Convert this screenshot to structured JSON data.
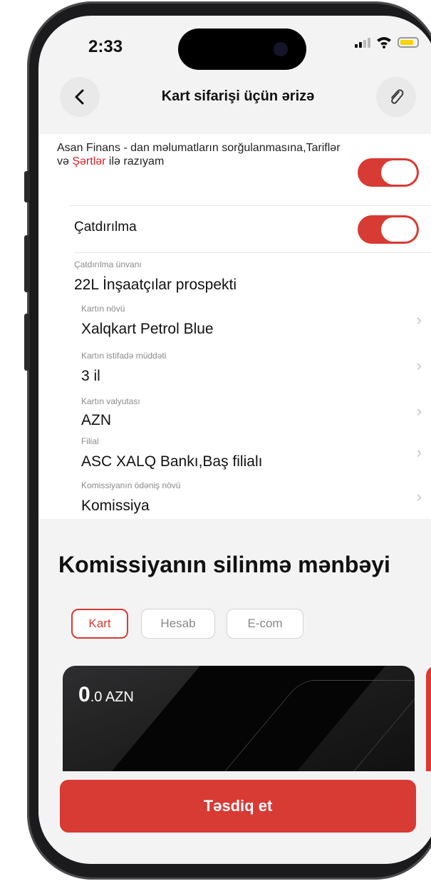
{
  "status_bar": {
    "time": "2:33"
  },
  "header": {
    "title": "Kart sifarişi üçün ərizə",
    "back_icon": "chevron-left-icon",
    "attach_icon": "paperclip-icon"
  },
  "consent": {
    "text_before": "Asan Finans - dan məlumatların sorğulanmasına,Tariflər və ",
    "link": "Şərtlər",
    "text_after": " ilə razıyam",
    "enabled": true
  },
  "delivery": {
    "label": "Çatdırılma",
    "enabled": true
  },
  "fields": [
    {
      "label": "Çatdırılma ünvanı",
      "value": "22L İnşaatçılar prospekti"
    },
    {
      "label": "Kartın növü",
      "value": "Xalqkart Petrol Blue"
    },
    {
      "label": "Kartın istifadə müddəti",
      "value": "3 il"
    },
    {
      "label": "Kartın valyutası",
      "value": "AZN"
    },
    {
      "label": "Filial",
      "value": "ASC XALQ Bankı,Baş filialı"
    },
    {
      "label": "Komissiyanın ödəniş növü",
      "value": "Komissiya"
    }
  ],
  "source": {
    "title": "Komissiyanın silinmə mənbəyi",
    "tabs": [
      "Kart",
      "Hesab",
      "E-com"
    ],
    "active_tab": "Kart"
  },
  "card": {
    "balance_int": "0",
    "balance_rest": ".0 AZN"
  },
  "confirm_label": "Təsdiq et",
  "colors": {
    "accent": "#d83a34"
  }
}
